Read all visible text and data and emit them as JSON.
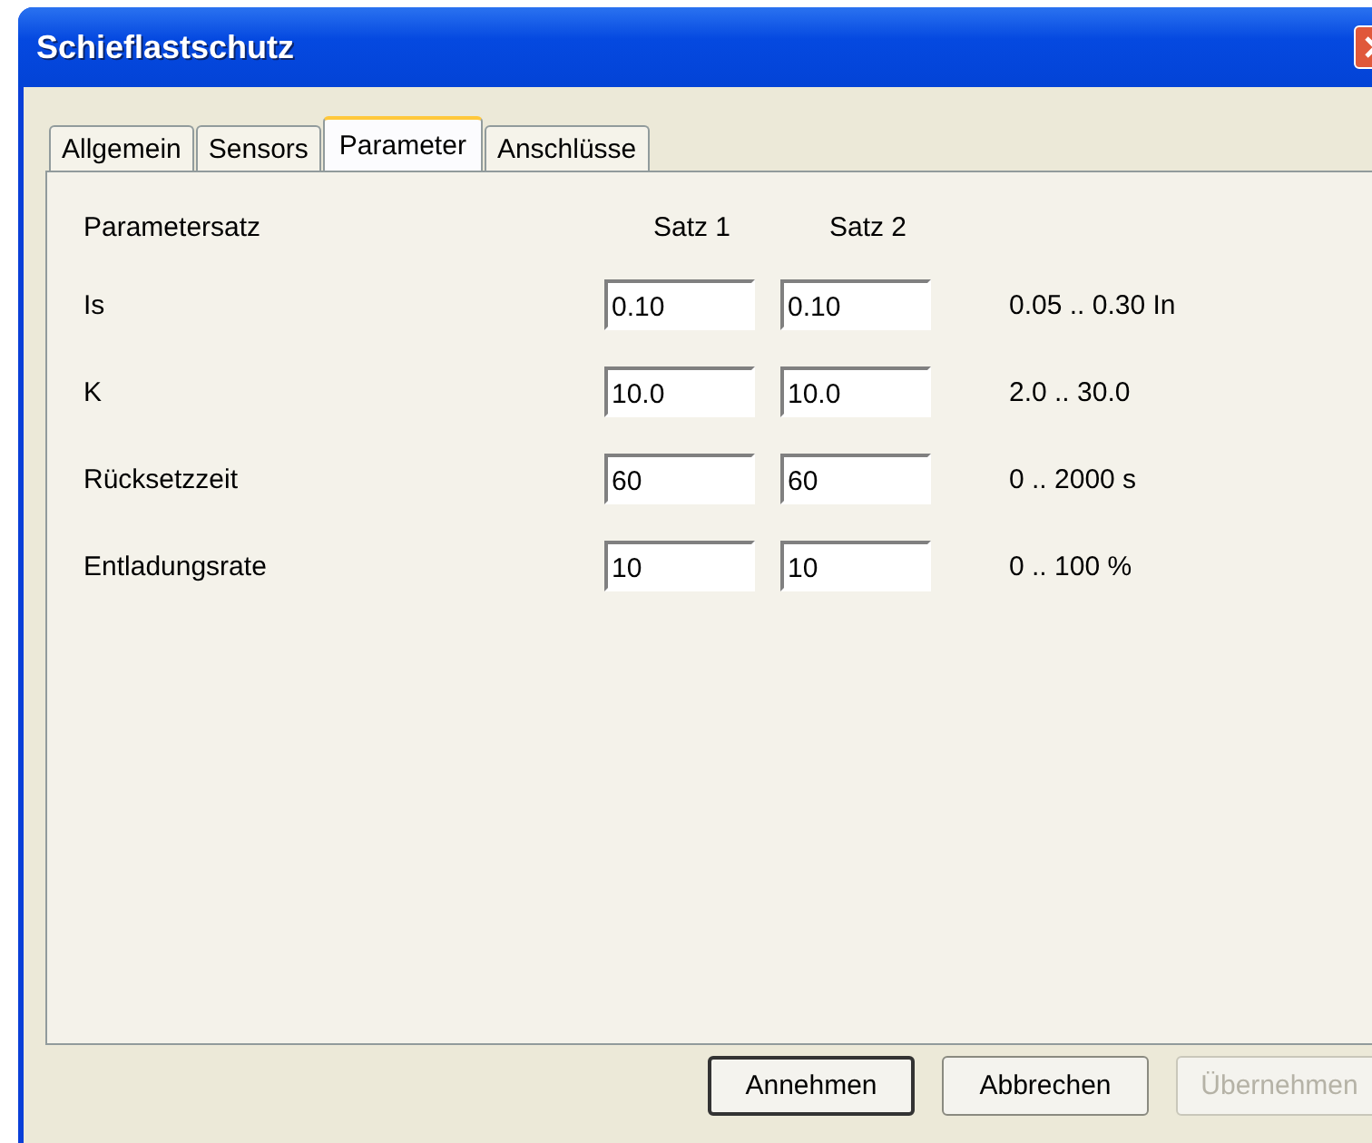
{
  "window": {
    "title": "Schieflastschutz"
  },
  "tabs": [
    {
      "label": "Allgemein",
      "selected": false
    },
    {
      "label": "Sensors",
      "selected": false
    },
    {
      "label": "Parameter",
      "selected": true
    },
    {
      "label": "Anschlüsse",
      "selected": false
    }
  ],
  "parameters": {
    "heading": "Parametersatz",
    "columns": [
      "Satz 1",
      "Satz 2"
    ],
    "rows": [
      {
        "label": "Is",
        "values": [
          "0.10",
          "0.10"
        ],
        "range": "0.05 .. 0.30  In"
      },
      {
        "label": "K",
        "values": [
          "10.0",
          "10.0"
        ],
        "range": "2.0 .. 30.0"
      },
      {
        "label": "Rücksetzzeit",
        "values": [
          "60",
          "60"
        ],
        "range": "0 .. 2000 s"
      },
      {
        "label": "Entladungsrate",
        "values": [
          "10",
          "10"
        ],
        "range": "0 .. 100 %"
      }
    ]
  },
  "buttons": [
    {
      "label": "Annehmen",
      "default": true,
      "disabled": false
    },
    {
      "label": "Abbrechen",
      "default": false,
      "disabled": false
    },
    {
      "label": "Übernehmen",
      "default": false,
      "disabled": true
    }
  ]
}
